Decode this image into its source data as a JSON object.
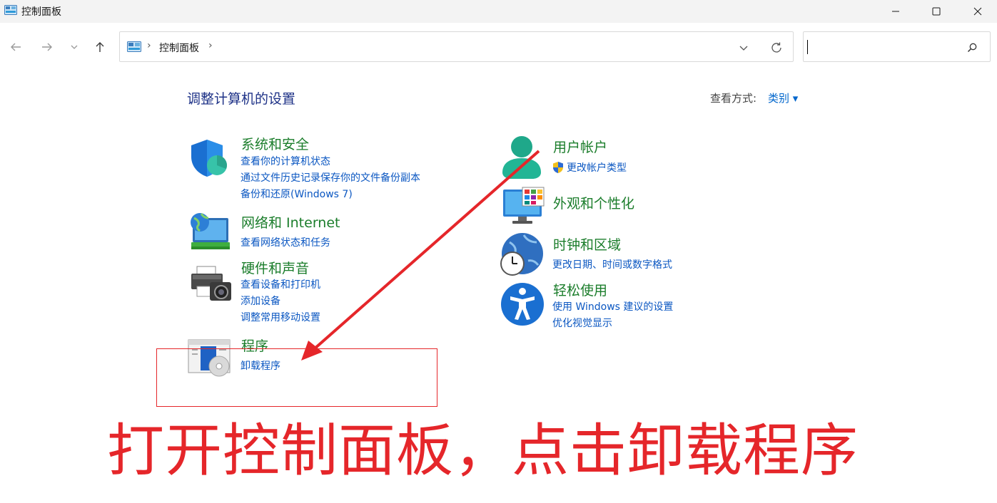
{
  "window": {
    "title": "控制面板",
    "minimize_icon": "minimize-icon",
    "maximize_icon": "maximize-icon",
    "close_icon": "close-icon"
  },
  "nav": {
    "back_icon": "arrow-left-icon",
    "forward_icon": "arrow-right-icon",
    "recent_icon": "chevron-down-icon",
    "up_icon": "arrow-up-icon"
  },
  "address": {
    "separator": "›",
    "path": "控制面板",
    "trailing_separator": "›"
  },
  "search": {
    "placeholder": "",
    "value": ""
  },
  "content": {
    "heading": "调整计算机的设置",
    "view_by_label": "查看方式:",
    "view_by_value": "类别 ▾"
  },
  "categories": {
    "system": {
      "title": "系统和安全",
      "links": [
        "查看你的计算机状态",
        "通过文件历史记录保存你的文件备份副本",
        "备份和还原(Windows 7)"
      ]
    },
    "network": {
      "title": "网络和 Internet",
      "links": [
        "查看网络状态和任务"
      ]
    },
    "hardware": {
      "title": "硬件和声音",
      "links": [
        "查看设备和打印机",
        "添加设备",
        "调整常用移动设置"
      ]
    },
    "programs": {
      "title": "程序",
      "links": [
        "卸载程序"
      ]
    },
    "users": {
      "title": "用户帐户",
      "links": [
        "更改帐户类型"
      ]
    },
    "appearance": {
      "title": "外观和个性化",
      "links": []
    },
    "clock": {
      "title": "时钟和区域",
      "links": [
        "更改日期、时间或数字格式"
      ]
    },
    "ease": {
      "title": "轻松使用",
      "links": [
        "使用 Windows 建议的设置",
        "优化视觉显示"
      ]
    }
  },
  "annotation": {
    "caption": "打开控制面板，点击卸载程序",
    "color": "#e5262a"
  },
  "colors": {
    "category_title": "#1b7d2b",
    "link": "#0b57c2",
    "heading": "#1e3287"
  }
}
